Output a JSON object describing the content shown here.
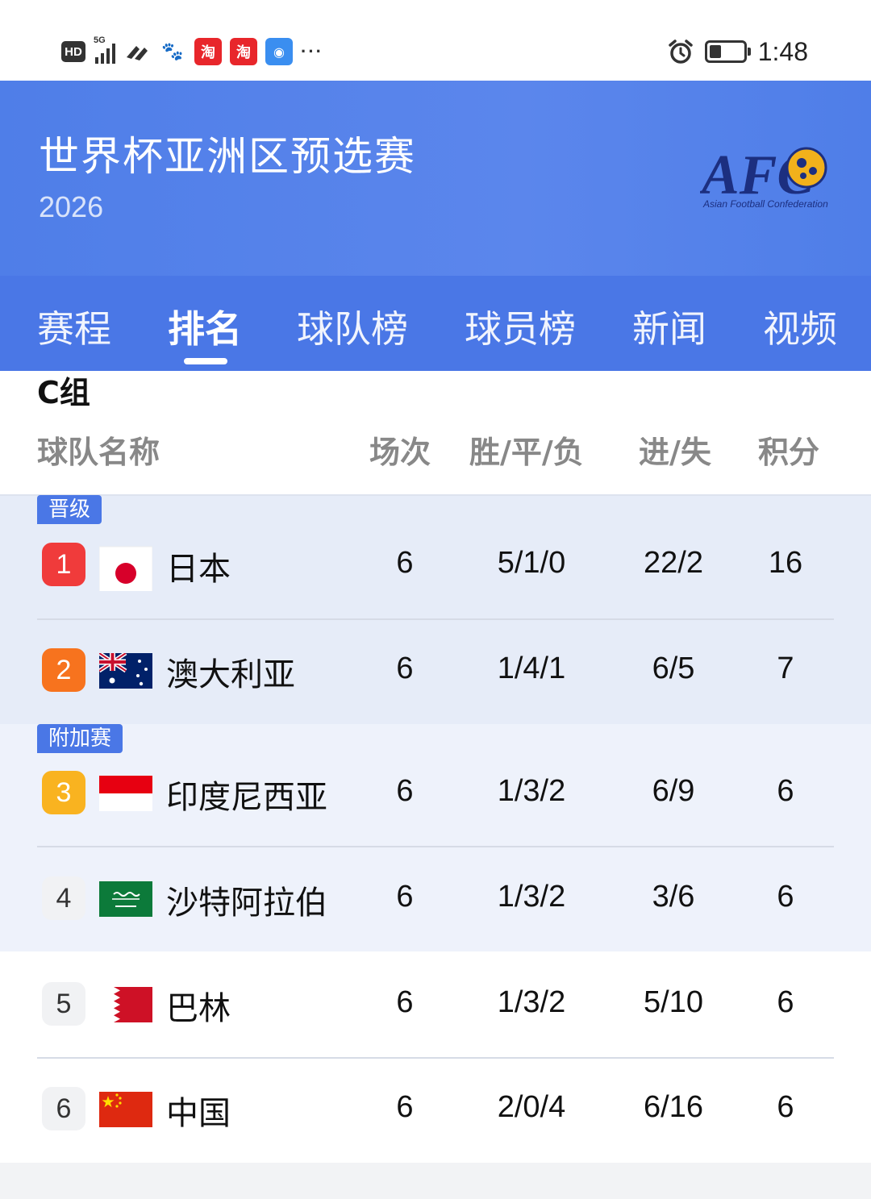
{
  "status_bar": {
    "hd_label": "HD",
    "network_label": "5G",
    "app_icons": [
      "pinwheel-icon",
      "baidu-icon",
      "taobao-icon",
      "taobao-icon",
      "security-icon"
    ],
    "time": "1:48"
  },
  "header": {
    "title": "世界杯亚洲区预选赛",
    "year": "2026",
    "logo_text": "AFC",
    "logo_subtext": "Asian Football Confederation",
    "bg_color": "#5b86ec"
  },
  "tabs": [
    {
      "label": "赛程",
      "active": false
    },
    {
      "label": "排名",
      "active": true
    },
    {
      "label": "球队榜",
      "active": false
    },
    {
      "label": "球员榜",
      "active": false
    },
    {
      "label": "新闻",
      "active": false
    },
    {
      "label": "视频",
      "active": false
    }
  ],
  "group": "C组",
  "columns": {
    "team": "球队名称",
    "games": "场次",
    "wdl": "胜/平/负",
    "gfga": "进/失",
    "points": "积分"
  },
  "zones": {
    "qualified": "晋级",
    "playoff": "附加赛"
  },
  "rows": [
    {
      "rank": "1",
      "team": "日本",
      "flag": "japan-flag",
      "games": "6",
      "wdl": "5/1/0",
      "gfga": "22/2",
      "points": "16"
    },
    {
      "rank": "2",
      "team": "澳大利亚",
      "flag": "australia-flag",
      "games": "6",
      "wdl": "1/4/1",
      "gfga": "6/5",
      "points": "7"
    },
    {
      "rank": "3",
      "team": "印度尼西亚",
      "flag": "indonesia-flag",
      "games": "6",
      "wdl": "1/3/2",
      "gfga": "6/9",
      "points": "6"
    },
    {
      "rank": "4",
      "team": "沙特阿拉伯",
      "flag": "saudi-arabia-flag",
      "games": "6",
      "wdl": "1/3/2",
      "gfga": "3/6",
      "points": "6"
    },
    {
      "rank": "5",
      "team": "巴林",
      "flag": "bahrain-flag",
      "games": "6",
      "wdl": "1/3/2",
      "gfga": "5/10",
      "points": "6"
    },
    {
      "rank": "6",
      "team": "中国",
      "flag": "china-flag",
      "games": "6",
      "wdl": "2/0/4",
      "gfga": "6/16",
      "points": "6"
    }
  ],
  "colors": {
    "accent": "#4a77e6",
    "rank1": "#f03b3b",
    "rank2": "#f7731e",
    "rank3": "#f9b320"
  }
}
